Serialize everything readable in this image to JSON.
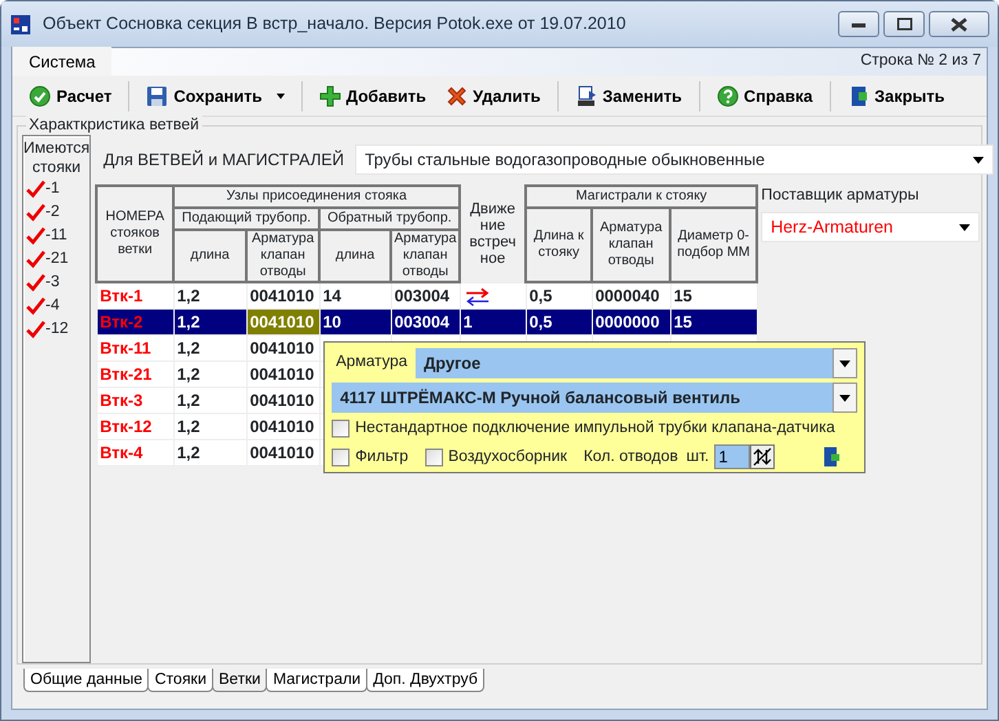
{
  "window": {
    "title": "Объект Сосновка секция В встр_начало. Версия Potok.exe от 19.07.2010"
  },
  "menu": [
    "Система"
  ],
  "row_status": "Строка № 2 из 7",
  "toolbar": [
    {
      "kind": "calc",
      "label": "Расчет",
      "dropdown": false
    },
    {
      "kind": "save",
      "label": "Сохранить",
      "dropdown": true
    },
    {
      "kind": "add",
      "label": "Добавить",
      "dropdown": false
    },
    {
      "kind": "delete",
      "label": "Удалить",
      "dropdown": false
    },
    {
      "kind": "replace",
      "label": "Заменить",
      "dropdown": false
    },
    {
      "kind": "help",
      "label": "Справка",
      "dropdown": false
    },
    {
      "kind": "close",
      "label": "Закрыть",
      "dropdown": false
    }
  ],
  "group_title": "Характкристика ветвей",
  "risers": {
    "title": "Имеются стояки",
    "items": [
      {
        "label": "-1",
        "checked": true
      },
      {
        "label": "-2",
        "checked": true
      },
      {
        "label": "-11",
        "checked": true
      },
      {
        "label": "-21",
        "checked": true
      },
      {
        "label": "-3",
        "checked": true
      },
      {
        "label": "-4",
        "checked": true
      },
      {
        "label": "-12",
        "checked": true
      }
    ]
  },
  "pipe_type": {
    "label": "Для  ВЕТВЕЙ и МАГИСТРАЛЕЙ",
    "value": "Трубы стальные водогазопроводные обыкновенные"
  },
  "supplier": {
    "label": "Поставщик арматуры",
    "value": "Herz-Armaturen"
  },
  "table": {
    "headers": {
      "number": "НОМЕРА стояков ветки",
      "nodes": "Узлы присоединения стояка",
      "supply": "Подающий трубопр.",
      "return": "Обратный трубопр.",
      "length_1": "длина",
      "fitting_1": "Арматура клапан отводы",
      "length_2": "длина",
      "fitting_2": "Арматура клапан отводы",
      "counter_flow": "Движе ние встреч ное",
      "mains": "Магистрали к стояку",
      "mains_length": "Длина к стояку",
      "mains_fitting": "Арматура клапан отводы",
      "diameter": "Диаметр 0-подбор ММ"
    },
    "rows": [
      {
        "name": "Втк-1",
        "selected": false,
        "cells": [
          {
            "kind": "text",
            "text": "1,2",
            "focused": false
          },
          {
            "kind": "text",
            "text": "0041010",
            "focused": false
          },
          {
            "kind": "text",
            "text": "14",
            "focused": false
          },
          {
            "kind": "text",
            "text": "003004",
            "focused": false
          },
          {
            "kind": "arrows",
            "focused": false
          },
          {
            "kind": "text",
            "text": "0,5",
            "focused": false
          },
          {
            "kind": "text",
            "text": "0000040",
            "focused": false
          },
          {
            "kind": "text",
            "text": "15",
            "focused": false
          }
        ]
      },
      {
        "name": "Втк-2",
        "selected": true,
        "cells": [
          {
            "kind": "text",
            "text": "1,2",
            "focused": false
          },
          {
            "kind": "text",
            "text": "0041010",
            "focused": true
          },
          {
            "kind": "text",
            "text": "10",
            "focused": false
          },
          {
            "kind": "text",
            "text": "003004",
            "focused": false
          },
          {
            "kind": "text",
            "text": "1",
            "focused": false
          },
          {
            "kind": "text",
            "text": "0,5",
            "focused": false
          },
          {
            "kind": "text",
            "text": "0000000",
            "focused": false
          },
          {
            "kind": "text",
            "text": "15",
            "focused": false
          }
        ]
      },
      {
        "name": "Втк-11",
        "selected": false,
        "cells": [
          {
            "kind": "text",
            "text": "1,2",
            "focused": false
          },
          {
            "kind": "text",
            "text": "0041010",
            "focused": false
          }
        ]
      },
      {
        "name": "Втк-21",
        "selected": false,
        "cells": [
          {
            "kind": "text",
            "text": "1,2",
            "focused": false
          },
          {
            "kind": "text",
            "text": "0041010",
            "focused": false
          }
        ]
      },
      {
        "name": "Втк-3",
        "selected": false,
        "cells": [
          {
            "kind": "text",
            "text": "1,2",
            "focused": false
          },
          {
            "kind": "text",
            "text": "0041010",
            "focused": false
          }
        ]
      },
      {
        "name": "Втк-12",
        "selected": false,
        "cells": [
          {
            "kind": "text",
            "text": "1,2",
            "focused": false
          },
          {
            "kind": "text",
            "text": "0041010",
            "focused": false
          }
        ]
      },
      {
        "name": "Втк-4",
        "selected": false,
        "cells": [
          {
            "kind": "text",
            "text": "1,2",
            "focused": false
          },
          {
            "kind": "text",
            "text": "0041010",
            "focused": false
          }
        ]
      }
    ]
  },
  "fitting_popup": {
    "label": "Арматура",
    "type_value": "Другое",
    "model_value": "4117 ШТРЁМАКС-М Ручной балансовый вентиль",
    "nonstandard": {
      "label": "Нестандартное подключение импульной трубки клапана-датчика",
      "checked": false
    },
    "filter": {
      "label": "Фильтр",
      "checked": false
    },
    "air_collector": {
      "label": "Воздухосборник",
      "checked": false
    },
    "bends_label": "Кол. отводов",
    "unit": "шт.",
    "bends_value": "1"
  },
  "tabs": [
    {
      "label": "Общие данные",
      "selected": false
    },
    {
      "label": "Стояки",
      "selected": false
    },
    {
      "label": "Ветки",
      "selected": true
    },
    {
      "label": "Магистрали",
      "selected": false
    },
    {
      "label": "Доп. Двухтруб",
      "selected": false
    }
  ]
}
